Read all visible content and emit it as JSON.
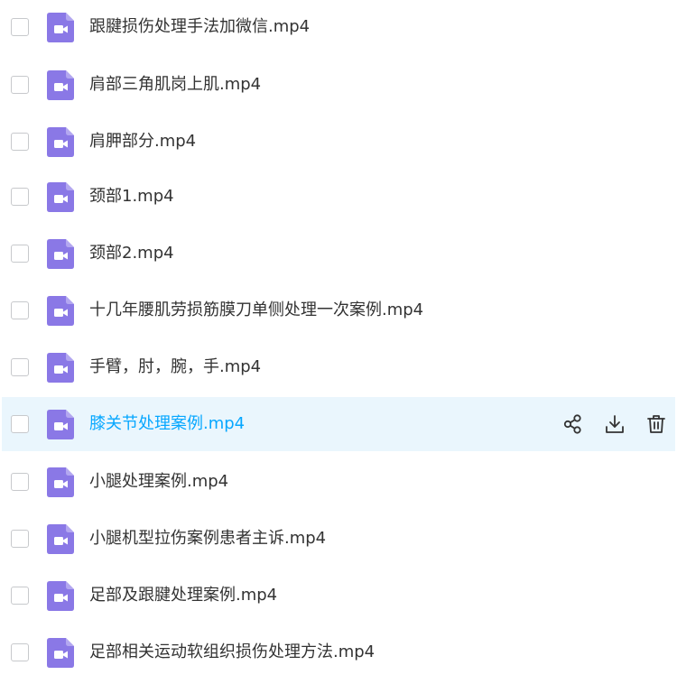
{
  "files": [
    {
      "name": "跟腱损伤处理手法加微信.mp4"
    },
    {
      "name": "肩部三角肌岗上肌.mp4"
    },
    {
      "name": "肩胛部分.mp4"
    },
    {
      "name": "颈部1.mp4"
    },
    {
      "name": "颈部2.mp4"
    },
    {
      "name": "十几年腰肌劳损筋膜刀单侧处理一次案例.mp4"
    },
    {
      "name": "手臂，肘，腕，手.mp4"
    },
    {
      "name": "膝关节处理案例.mp4"
    },
    {
      "name": "小腿处理案例.mp4"
    },
    {
      "name": "小腿机型拉伤案例患者主诉.mp4"
    },
    {
      "name": "足部及跟腱处理案例.mp4"
    },
    {
      "name": "足部相关运动软组织损伤处理方法.mp4"
    }
  ],
  "hovered_row_actions": {
    "share_icon": "share-icon",
    "download_icon": "download-icon",
    "delete_icon": "trash-icon"
  },
  "colors": {
    "icon_purple": "#8a78e6",
    "hover_bg": "#eaf6fd",
    "hover_text": "#06a7ff",
    "text": "#333333"
  }
}
